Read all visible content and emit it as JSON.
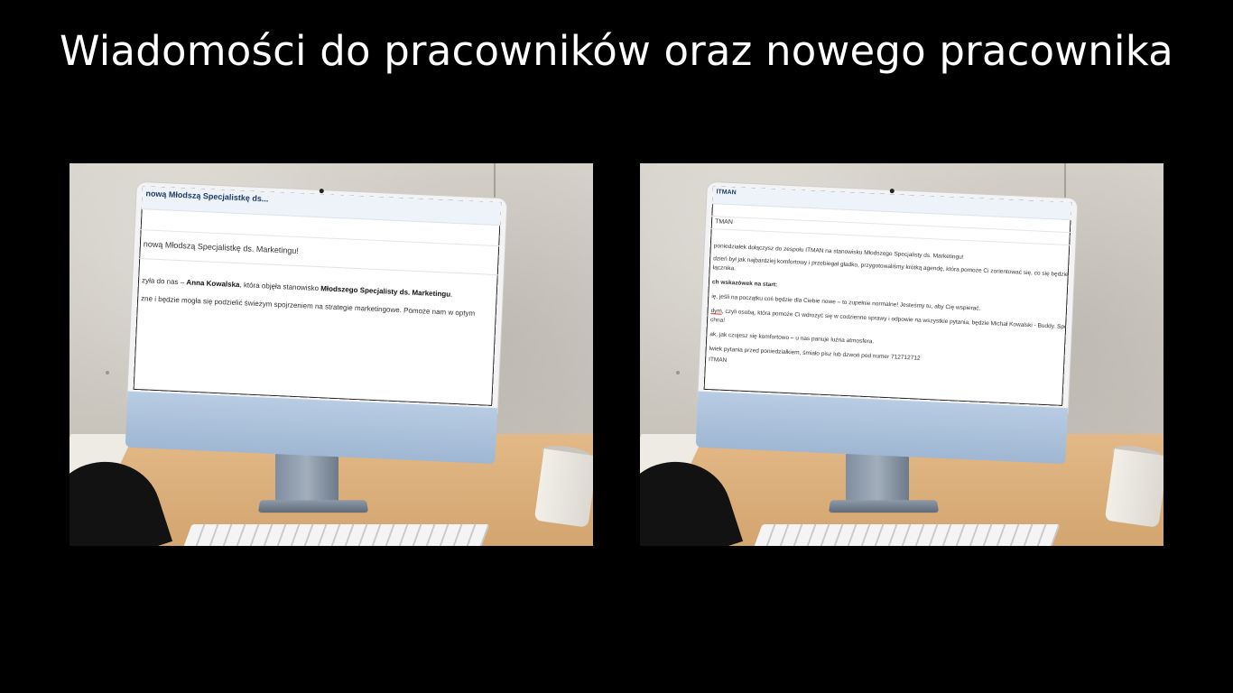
{
  "title": "Wiadomości do pracowników oraz nowego pracownika",
  "left_email": {
    "header": "nową Młodszą Specjalistkę ds...",
    "subject": "nową Młodszą Specjalistkę ds. Marketingu!",
    "line1_a": "zyła do nas – ",
    "line1_name": "Anna Kowalska",
    "line1_b": ", która objęła stanowisko ",
    "line1_role": "Młodszego Specjalisty ds. Marketingu",
    "line1_c": ".",
    "line2": "zne i będzie mogła się podzielić świeżym spojrzeniem na strategie marketingowe. Pomoże nam w optym"
  },
  "right_email": {
    "header": "ITMAN",
    "sender": "TMAN",
    "line1": "poniedziałek dołączysz do zespołu ITMAN na stanowisku Młodszego Specjalisty ds. Marketingu!",
    "line2": "dzień był jak najbardziej komfortowy i przebiegał gładko, przygotowaliśmy krótką agendę, która pomoże Ci zorientować się, co się będzie dz",
    "line3": "łącznika.",
    "section": "ch wskazówek na start:",
    "line4": "ię, jeśli na początku coś będzie dla Ciebie nowe – to zupełnie normalne! Jesteśmy tu, aby Cię wspierać.",
    "line5_a": "dym",
    "line5_b": ", czyli osobą, która pomoże Ci wdrożyć się w codzienne sprawy i odpowie na wszystkie pytania, będzie Michał Kowalski - Buddy. Spotkacie",
    "line6": "chna!",
    "line7": "ak, jak czujesz się komfortowo – u nas panuje luźna atmosfera.",
    "line8": "lwiek pytania przed poniedziałkiem, śmiało pisz lub dzwoń pod numer 712712712",
    "signature": "ITMAN"
  }
}
